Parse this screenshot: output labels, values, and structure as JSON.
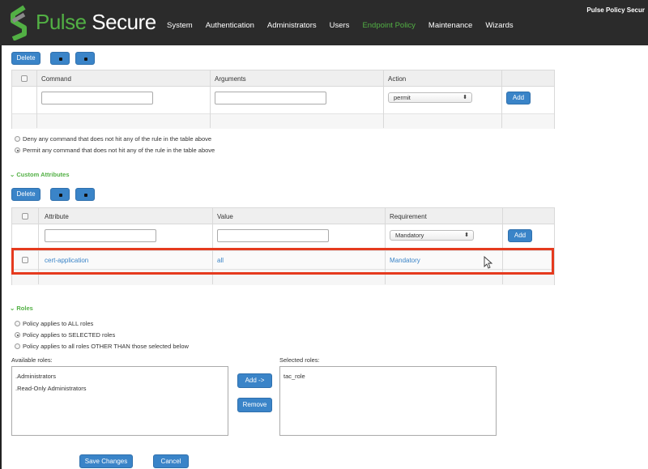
{
  "header": {
    "brand_prefix": "Pulse",
    "brand_suffix": " Secure",
    "user": "Pulse Policy Secur",
    "nav": [
      {
        "label": "System"
      },
      {
        "label": "Authentication"
      },
      {
        "label": "Administrators"
      },
      {
        "label": "Users"
      },
      {
        "label": "Endpoint Policy",
        "active": true
      },
      {
        "label": "Maintenance"
      },
      {
        "label": "Wizards"
      }
    ]
  },
  "commands": {
    "delete_label": "Delete",
    "columns": [
      "Command",
      "Arguments",
      "Action"
    ],
    "action_value": "permit",
    "add_label": "Add",
    "options": [
      {
        "label": "Deny any command that does not hit any of the rule in the table above",
        "selected": false
      },
      {
        "label": "Permit any command that does not hit any of the rule in the table above",
        "selected": true
      }
    ]
  },
  "custom_attributes": {
    "title": "Custom Attributes",
    "delete_label": "Delete",
    "columns": [
      "Attribute",
      "Value",
      "Requirement"
    ],
    "requirement_value": "Mandatory",
    "add_label": "Add",
    "rows": [
      {
        "attribute": "cert-application",
        "value": "all",
        "requirement": "Mandatory"
      }
    ]
  },
  "roles": {
    "title": "Roles",
    "options": [
      {
        "label": "Policy applies to ALL roles",
        "selected": false
      },
      {
        "label": "Policy applies to SELECTED roles",
        "selected": true
      },
      {
        "label": "Policy applies to all roles OTHER THAN those selected below",
        "selected": false
      }
    ],
    "available_label": "Available roles:",
    "available": [
      ".Administrators",
      ".Read-Only Administrators"
    ],
    "selected_label": "Selected roles:",
    "selected": [
      "tac_role"
    ],
    "add_label": "Add ->",
    "remove_label": "Remove"
  },
  "footer": {
    "save_label": "Save Changes",
    "cancel_label": "Cancel"
  },
  "colors": {
    "accent_green": "#52b044",
    "button_blue": "#3a84c8",
    "highlight_red": "#e53a1e"
  }
}
